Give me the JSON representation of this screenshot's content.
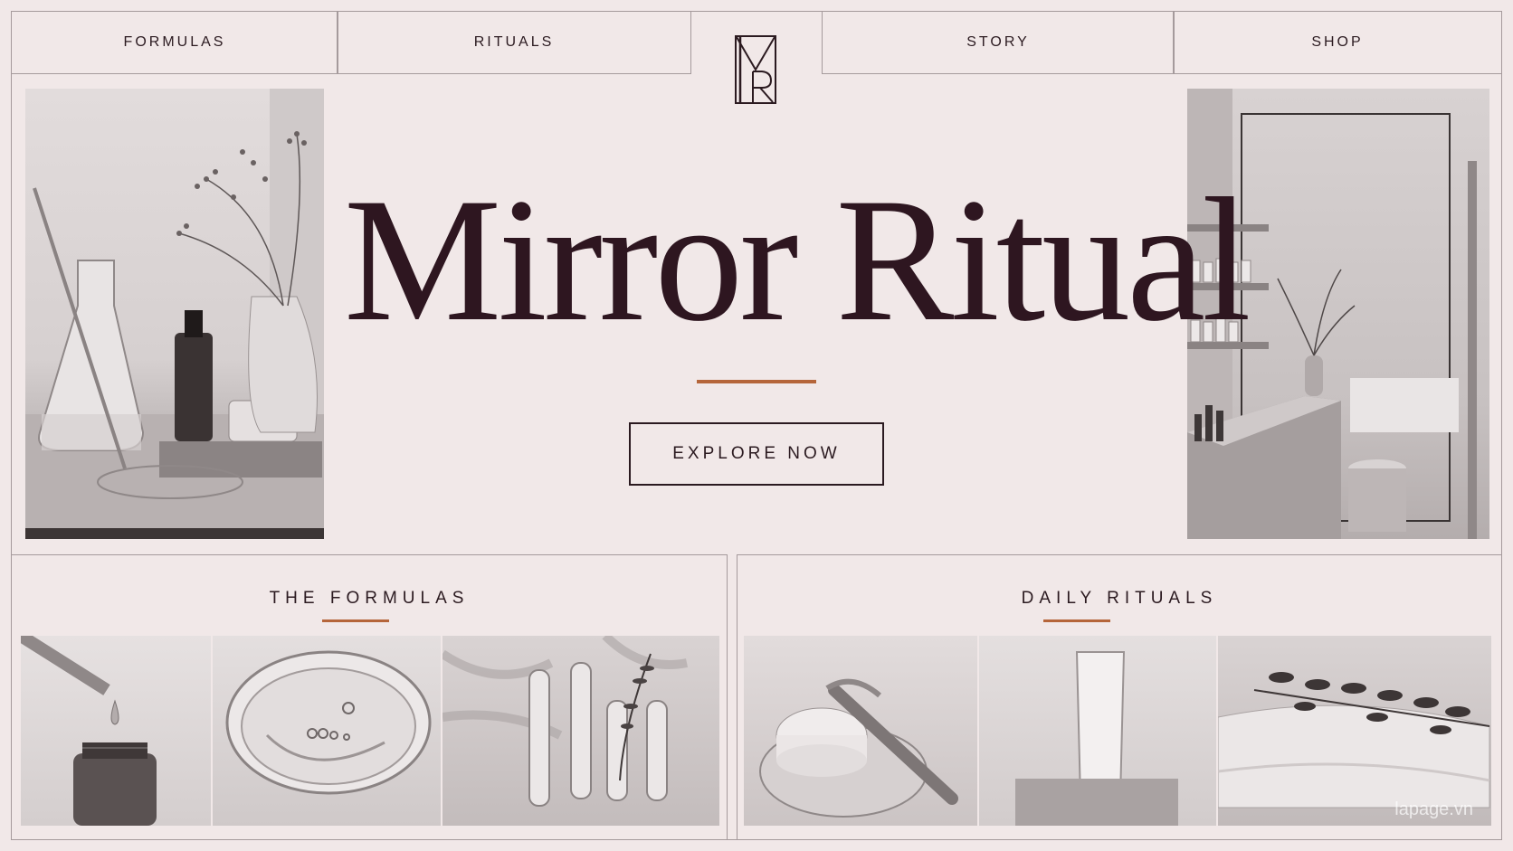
{
  "nav": {
    "formulas": "FORMULAS",
    "rituals": "RITUALS",
    "story": "STORY",
    "shop": "SHOP"
  },
  "logo": {
    "monogram": "MR"
  },
  "hero": {
    "title": "Mirror Ritual",
    "cta_label": "EXPLORE NOW",
    "left_image": "lab-glassware-serum-flowers-photo",
    "right_image": "minimal-bathroom-interior-photo"
  },
  "sections": {
    "formulas": {
      "title": "THE FORMULAS",
      "images": [
        "serum-dropper-bottle-photo",
        "gel-petri-dish-photo",
        "test-tubes-sprig-photo"
      ]
    },
    "rituals": {
      "title": "DAILY RITUALS",
      "images": [
        "sponge-brush-dish-photo",
        "cream-tube-stone-photo",
        "towel-eucalyptus-photo"
      ]
    }
  },
  "watermark": "lapage.vn",
  "colors": {
    "background": "#f1e8e8",
    "text": "#2b1a20",
    "title": "#2e1620",
    "accent": "#b5653a",
    "border": "#a59a9c"
  }
}
